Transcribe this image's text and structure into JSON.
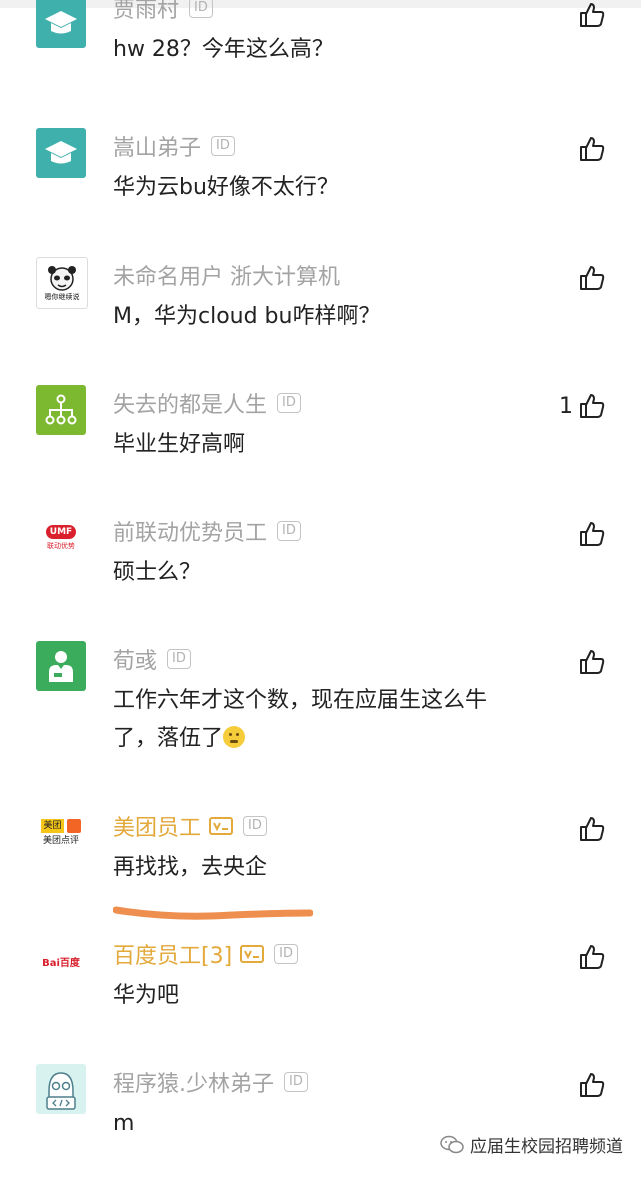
{
  "comments": [
    {
      "name": "贾雨村",
      "text": "hw 28？今年这么高？",
      "like_count": "",
      "avatar": "graduation-cap-avatar",
      "avatar_color": "#3fb0ac"
    },
    {
      "name": "嵩山弟子",
      "text": "华为云bu好像不太行？",
      "like_count": "",
      "avatar": "graduation-cap-avatar",
      "avatar_color": "#3fb0ac"
    },
    {
      "name": "未命名用户 浙大计算机",
      "text": "M，华为cloud bu咋样啊？",
      "like_count": "",
      "avatar": "panda-meme-avatar",
      "avatar_caption": "嗯你继续说"
    },
    {
      "name": "失去的都是人生",
      "text": "毕业生好高啊",
      "like_count": "1",
      "avatar": "org-chart-avatar",
      "avatar_color": "#7cb830"
    },
    {
      "name": "前联动优势员工",
      "text": "硕士么？",
      "like_count": "",
      "avatar": "umf-logo-avatar",
      "avatar_logo": "UMF",
      "avatar_caption": "联动优势"
    },
    {
      "name": "荀彧",
      "text_line1": "工作六年才这个数，现在应届生这么牛",
      "text_line2": "了，落伍了",
      "like_count": "",
      "avatar": "staff-avatar",
      "avatar_color": "#3aac5c"
    },
    {
      "name": "美团员工",
      "text": "再找找，去央企",
      "like_count": "",
      "avatar": "meituan-logo-avatar",
      "avatar_logo": "美团",
      "avatar_caption": "美团点评"
    },
    {
      "name": "百度员工[3]",
      "text": "华为吧",
      "like_count": "",
      "avatar": "baidu-logo-avatar",
      "avatar_logo": "Bai百度"
    },
    {
      "name": "程序猿.少林弟子",
      "text": "m",
      "like_count": "",
      "avatar": "programmer-avatar"
    }
  ],
  "id_badge_label": "ID",
  "watermark": {
    "text": "应届生校园招聘频道",
    "icon": "wechat-icon"
  },
  "colors": {
    "name_gray": "#a3a3a3",
    "name_verified": "#e3a93b",
    "text": "#222222",
    "underline": "#ef8f4f"
  }
}
